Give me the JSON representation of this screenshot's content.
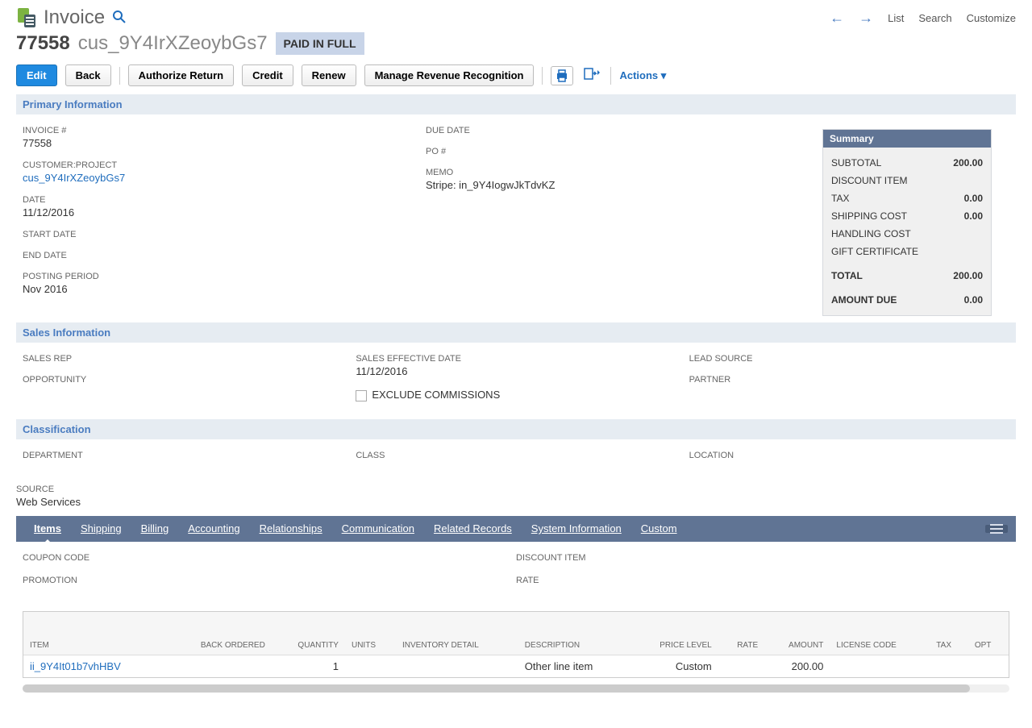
{
  "header": {
    "title": "Invoice",
    "nav": {
      "list": "List",
      "search": "Search",
      "customize": "Customize"
    }
  },
  "record": {
    "number": "77558",
    "customer_id": "cus_9Y4IrXZeoybGs7",
    "status": "PAID IN FULL"
  },
  "toolbar": {
    "edit": "Edit",
    "back": "Back",
    "authorize_return": "Authorize Return",
    "credit": "Credit",
    "renew": "Renew",
    "manage_rev": "Manage Revenue Recognition",
    "actions": "Actions"
  },
  "sections": {
    "primary": "Primary Information",
    "sales": "Sales Information",
    "classification": "Classification"
  },
  "primary": {
    "invoice_num_label": "INVOICE #",
    "invoice_num": "77558",
    "customer_project_label": "CUSTOMER:PROJECT",
    "customer_project": "cus_9Y4IrXZeoybGs7",
    "date_label": "DATE",
    "date": "11/12/2016",
    "start_date_label": "START DATE",
    "end_date_label": "END DATE",
    "posting_period_label": "POSTING PERIOD",
    "posting_period": "Nov 2016",
    "due_date_label": "DUE DATE",
    "po_label": "PO #",
    "memo_label": "MEMO",
    "memo": "Stripe: in_9Y4IogwJkTdvKZ"
  },
  "summary": {
    "title": "Summary",
    "subtotal_label": "SUBTOTAL",
    "subtotal": "200.00",
    "discount_label": "DISCOUNT ITEM",
    "discount": "",
    "tax_label": "TAX",
    "tax": "0.00",
    "shipping_label": "SHIPPING COST",
    "shipping": "0.00",
    "handling_label": "HANDLING COST",
    "handling": "",
    "gift_label": "GIFT CERTIFICATE",
    "gift": "",
    "total_label": "TOTAL",
    "total": "200.00",
    "amount_due_label": "AMOUNT DUE",
    "amount_due": "0.00"
  },
  "sales": {
    "sales_rep_label": "SALES REP",
    "opportunity_label": "OPPORTUNITY",
    "sales_eff_date_label": "SALES EFFECTIVE DATE",
    "sales_eff_date": "11/12/2016",
    "exclude_comm_label": "EXCLUDE COMMISSIONS",
    "lead_source_label": "LEAD SOURCE",
    "partner_label": "PARTNER"
  },
  "classification": {
    "department_label": "DEPARTMENT",
    "class_label": "CLASS",
    "location_label": "LOCATION"
  },
  "source": {
    "label": "SOURCE",
    "value": "Web Services"
  },
  "tabs": [
    "Items",
    "Shipping",
    "Billing",
    "Accounting",
    "Relationships",
    "Communication",
    "Related Records",
    "System Information",
    "Custom"
  ],
  "items_meta": {
    "coupon_label": "COUPON CODE",
    "promotion_label": "PROMOTION",
    "discount_item_label": "DISCOUNT ITEM",
    "rate_label": "RATE"
  },
  "line_table": {
    "headers": {
      "item": "ITEM",
      "back_ordered": "BACK ORDERED",
      "quantity": "QUANTITY",
      "units": "UNITS",
      "inventory_detail": "INVENTORY DETAIL",
      "description": "DESCRIPTION",
      "price_level": "PRICE LEVEL",
      "rate": "RATE",
      "amount": "AMOUNT",
      "license_code": "LICENSE CODE",
      "tax": "TAX",
      "opt": "OPT"
    },
    "rows": [
      {
        "item": "ii_9Y4It01b7vhHBV",
        "back_ordered": "",
        "quantity": "1",
        "units": "",
        "inventory_detail": "",
        "description": "Other line item",
        "price_level": "Custom",
        "rate": "",
        "amount": "200.00",
        "license_code": "",
        "tax": "",
        "opt": ""
      }
    ]
  }
}
